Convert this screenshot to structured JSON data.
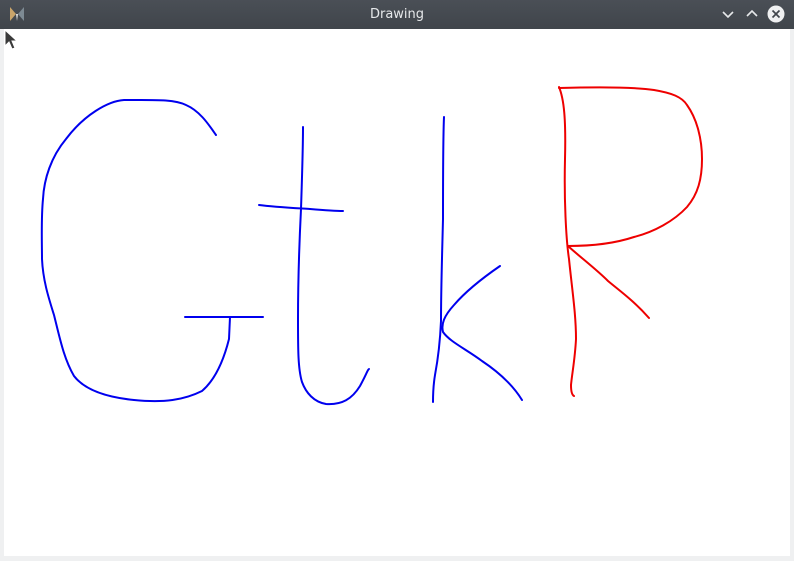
{
  "window": {
    "title": "Drawing"
  },
  "titlebar": {
    "app_icon": "gtk-app-icon",
    "buttons": [
      {
        "name": "minimize",
        "icon": "chevron-down-icon"
      },
      {
        "name": "maximize",
        "icon": "chevron-up-icon"
      },
      {
        "name": "close",
        "icon": "close-icon"
      }
    ]
  },
  "canvas": {
    "background": "#ffffff",
    "strokes": [
      {
        "label": "G",
        "color": "#0000ee"
      },
      {
        "label": "t",
        "color": "#0000ee"
      },
      {
        "label": "k",
        "color": "#0000ee"
      },
      {
        "label": "R",
        "color": "#ee0000"
      }
    ]
  },
  "colors": {
    "blue_pen": "#0000ee",
    "red_pen": "#ee0000",
    "titlebar": "#454a50"
  }
}
